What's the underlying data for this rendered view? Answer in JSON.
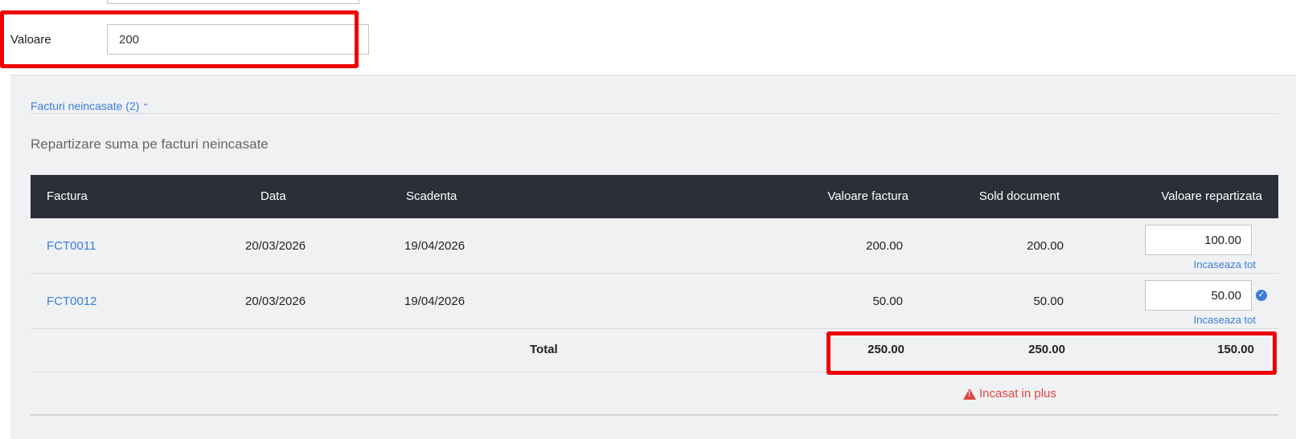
{
  "form": {
    "value_label": "Valoare",
    "value_input": "200"
  },
  "unpaid": {
    "toggle_label": "Facturi neincasate (2)",
    "section_title": "Repartizare suma pe facturi neincasate",
    "columns": {
      "invoice": "Factura",
      "date": "Data",
      "due": "Scadenta",
      "invoice_value": "Valoare factura",
      "balance": "Sold document",
      "allocated": "Valoare repartizata"
    },
    "rows": [
      {
        "invoice": "FCT0011",
        "date": "20/03/2026",
        "due": "19/04/2026",
        "invoice_value": "200.00",
        "balance": "200.00",
        "allocated": "100.00",
        "collect_all": "Incaseaza tot"
      },
      {
        "invoice": "FCT0012",
        "date": "20/03/2026",
        "due": "19/04/2026",
        "invoice_value": "50.00",
        "balance": "50.00",
        "allocated": "50.00",
        "collect_all": "Incaseaza tot"
      }
    ],
    "total": {
      "label": "Total",
      "invoice_value": "250.00",
      "balance": "250.00",
      "allocated": "150.00"
    },
    "warning": "Incasat in plus"
  },
  "colors": {
    "accent": "#3b7dd8",
    "header_bg": "#2c2f38",
    "warning": "#e24444",
    "highlight": "#ee0000"
  }
}
